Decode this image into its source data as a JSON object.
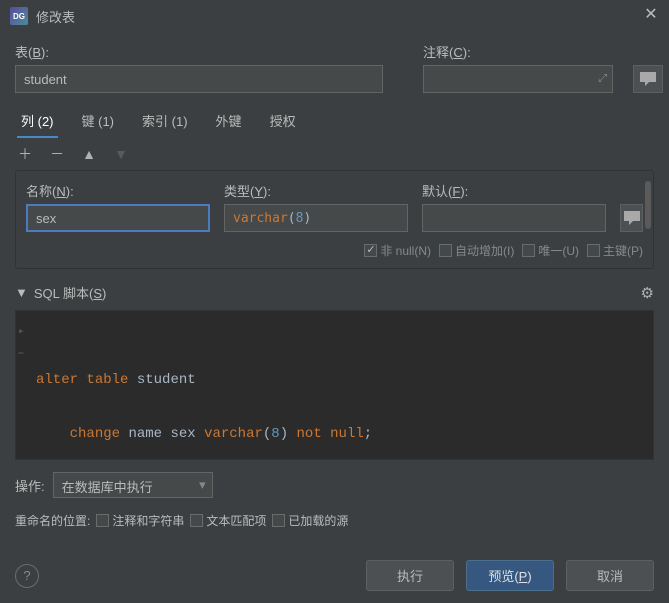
{
  "window": {
    "title": "修改表",
    "app_icon_text": "DG"
  },
  "labels": {
    "table": "表",
    "table_hotkey": "B",
    "comment": "注释",
    "comment_hotkey": "C",
    "name": "名称",
    "name_hotkey": "N",
    "type": "类型",
    "type_hotkey": "Y",
    "default": "默认",
    "default_hotkey": "F",
    "sql_script": "SQL 脚本",
    "sql_hotkey": "S",
    "action": "操作:",
    "rename_position": "重命名的位置:",
    "comment_and_str": "注释和字符串",
    "text_match": "文本匹配项",
    "loaded_source": "已加载的源"
  },
  "values": {
    "table_name": "student",
    "comment": "",
    "column_name": "sex",
    "column_type_prefix": "varchar",
    "column_type_num": "8",
    "column_default": "",
    "action_select": "在数据库中执行"
  },
  "tabs": [
    {
      "label": "列 (2)",
      "active": true
    },
    {
      "label": "键 (1)",
      "active": false
    },
    {
      "label": "索引 (1)",
      "active": false
    },
    {
      "label": "外键",
      "active": false
    },
    {
      "label": "授权",
      "active": false
    }
  ],
  "checks": {
    "not_null_label": "非 null(N)",
    "not_null_checked": true,
    "auto_inc_label": "自动增加(I)",
    "auto_inc_checked": false,
    "unique_label": "唯一(U)",
    "unique_checked": false,
    "pk_label": "主键(P)",
    "pk_checked": false
  },
  "rename_checks": {
    "comment_str": false,
    "text_match": false,
    "loaded_source": false
  },
  "sql": {
    "kw_alter": "alter",
    "kw_table": "table",
    "ident_student": "student",
    "kw_change": "change",
    "ident_name": "name",
    "ident_sex": "sex",
    "kw_varchar": "varchar",
    "num8": "8",
    "kw_not": "not",
    "kw_null": "null"
  },
  "buttons": {
    "run": "执行",
    "preview": "预览",
    "preview_hotkey": "P",
    "cancel": "取消"
  }
}
